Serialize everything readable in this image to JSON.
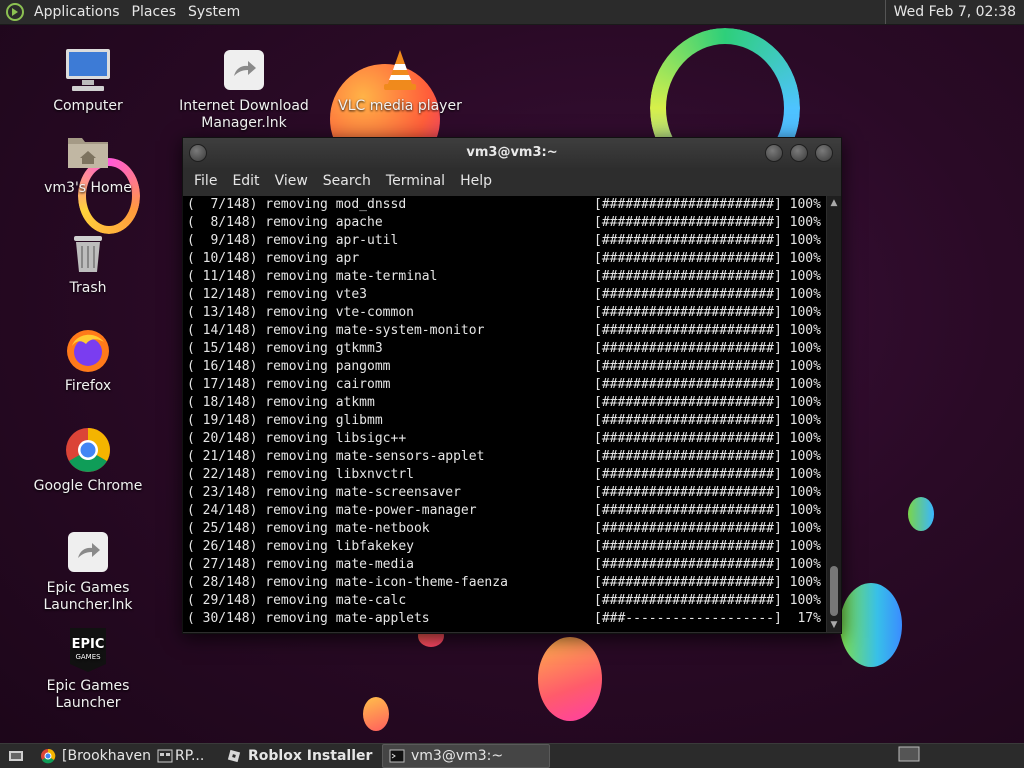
{
  "top_panel": {
    "menus": [
      "Applications",
      "Places",
      "System"
    ],
    "clock": "Wed Feb  7, 02:38"
  },
  "desktop_icons": [
    {
      "label": "Computer",
      "icon": "computer-icon"
    },
    {
      "label": "Internet Download Manager.lnk",
      "icon": "shortcut-icon"
    },
    {
      "label": "VLC media player",
      "icon": "vlc-icon"
    },
    {
      "label": "vm3's Home",
      "icon": "home-folder-icon"
    },
    {
      "label": "Trash",
      "icon": "trash-icon"
    },
    {
      "label": "Firefox",
      "icon": "firefox-icon"
    },
    {
      "label": "Google Chrome",
      "icon": "chrome-icon"
    },
    {
      "label": "Epic Games Launcher.lnk",
      "icon": "shortcut-icon"
    },
    {
      "label": "Epic Games Launcher",
      "icon": "epic-games-icon"
    }
  ],
  "terminal": {
    "title": "vm3@vm3:~",
    "menu": [
      "File",
      "Edit",
      "View",
      "Search",
      "Terminal",
      "Help"
    ],
    "lines": [
      "(  7/148) removing mod_dnssd                        [######################] 100%",
      "(  8/148) removing apache                           [######################] 100%",
      "(  9/148) removing apr-util                         [######################] 100%",
      "( 10/148) removing apr                              [######################] 100%",
      "( 11/148) removing mate-terminal                    [######################] 100%",
      "( 12/148) removing vte3                             [######################] 100%",
      "( 13/148) removing vte-common                       [######################] 100%",
      "( 14/148) removing mate-system-monitor              [######################] 100%",
      "( 15/148) removing gtkmm3                           [######################] 100%",
      "( 16/148) removing pangomm                          [######################] 100%",
      "( 17/148) removing cairomm                          [######################] 100%",
      "( 18/148) removing atkmm                            [######################] 100%",
      "( 19/148) removing glibmm                           [######################] 100%",
      "( 20/148) removing libsigc++                        [######################] 100%",
      "( 21/148) removing mate-sensors-applet              [######################] 100%",
      "( 22/148) removing libxnvctrl                       [######################] 100%",
      "( 23/148) removing mate-screensaver                 [######################] 100%",
      "( 24/148) removing mate-power-manager               [######################] 100%",
      "( 25/148) removing mate-netbook                     [######################] 100%",
      "( 26/148) removing libfakekey                       [######################] 100%",
      "( 27/148) removing mate-media                       [######################] 100%",
      "( 28/148) removing mate-icon-theme-faenza           [######################] 100%",
      "( 29/148) removing mate-calc                        [######################] 100%",
      "( 30/148) removing mate-applets                     [###-------------------]  17%"
    ]
  },
  "taskbar": {
    "tasks": [
      {
        "label": "[Brookhaven",
        "icon": "chrome-icon",
        "active": false
      },
      {
        "label": "RP...",
        "icon": "window-icon",
        "active": false
      },
      {
        "label": "Roblox Installer",
        "icon": "roblox-icon",
        "active": false
      },
      {
        "label": "vm3@vm3:~",
        "icon": "terminal-icon",
        "active": true
      }
    ]
  },
  "colors": {
    "desktop_bg": "#2a0a26",
    "panel_bg": "#2b2b2b",
    "terminal_bg": "#000000",
    "terminal_fg": "#e6e6e6"
  }
}
